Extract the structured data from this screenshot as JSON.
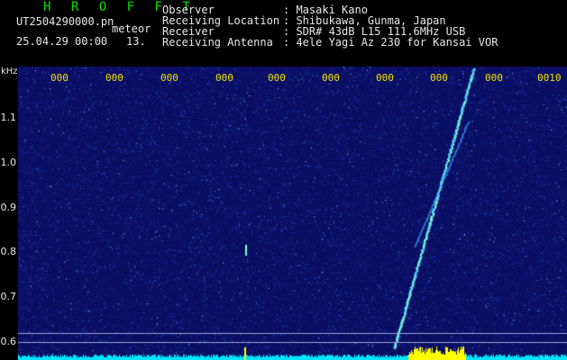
{
  "header": {
    "brand": "H R O F F T",
    "filename": "UT2504290000.pn",
    "mode": "meteor",
    "datetime": "25.04.29 00:00",
    "count": "13.",
    "info": [
      {
        "label": "Observer",
        "value": ": Masaki Kano"
      },
      {
        "label": "Receiving Location",
        "value": ": Shibukawa, Gunma, Japan"
      },
      {
        "label": "Receiver",
        "value": ": SDR# 43dB L15 111.6MHz USB"
      },
      {
        "label": "Receiving Antenna",
        "value": ": 4ele Yagi Az 230 for Kansai VOR"
      }
    ]
  },
  "y_axis": {
    "unit": "kHz",
    "ticks": [
      "1.1",
      "1.0",
      "0.9",
      "0.8",
      "0.7",
      "0.6"
    ]
  },
  "x_axis": {
    "ticks": [
      "000",
      "000",
      "000",
      "000",
      "000",
      "000",
      "000",
      "000",
      "000",
      "000",
      "0010"
    ]
  },
  "colors": {
    "background": "#0b0f63",
    "noise": "#3a6cff",
    "signal": "#7fffd4",
    "baseline": "#00e5ff",
    "burst": "#ffff00"
  }
}
